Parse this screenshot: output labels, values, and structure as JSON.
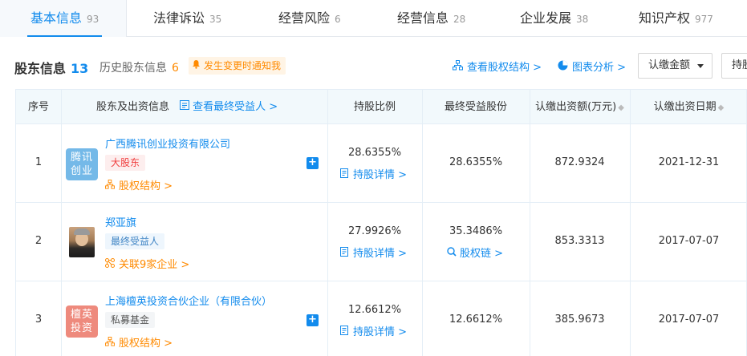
{
  "tabs": [
    {
      "label": "基本信息",
      "count": "93"
    },
    {
      "label": "法律诉讼",
      "count": "35"
    },
    {
      "label": "经营风险",
      "count": "6"
    },
    {
      "label": "经营信息",
      "count": "28"
    },
    {
      "label": "企业发展",
      "count": "38"
    },
    {
      "label": "知识产权",
      "count": "977"
    }
  ],
  "section": {
    "title": "股东信息",
    "count": "13",
    "history_label": "历史股东信息",
    "history_count": "6",
    "notice": "发生变更时通知我",
    "view_structure": "查看股权结构 >",
    "chart_analysis": "图表分析 >",
    "sort_select": "认缴金额",
    "sort_select2": "持股"
  },
  "table": {
    "headers": {
      "index": "序号",
      "shareholder": "股东及出资信息",
      "beneficiary_link": "查看最终受益人 >",
      "ratio": "持股比例",
      "final_share": "最终受益股份",
      "amount": "认缴出资额(万元)",
      "date": "认缴出资日期"
    },
    "rows": [
      {
        "index": "1",
        "logo_text": "腾讯创业",
        "name": "广西腾讯创业投资有限公司",
        "tag": "大股东",
        "sublink": "股权结构 >",
        "ratio": "28.6355%",
        "detail": "持股详情 >",
        "final_share": "28.6355%",
        "final_link": "",
        "amount": "872.9324",
        "date": "2021-12-31"
      },
      {
        "index": "2",
        "logo_text": "",
        "name": "郑亚旗",
        "tag": "最终受益人",
        "sublink": "关联9家企业 >",
        "ratio": "27.9926%",
        "detail": "持股详情 >",
        "final_share": "35.3486%",
        "final_link": "股权链 >",
        "amount": "853.3313",
        "date": "2017-07-07"
      },
      {
        "index": "3",
        "logo_text": "檀英投资",
        "name": "上海檀英投资合伙企业（有限合伙）",
        "tag": "私募基金",
        "sublink": "股权结构 >",
        "ratio": "12.6612%",
        "detail": "持股详情 >",
        "final_share": "12.6612%",
        "final_link": "",
        "amount": "385.9673",
        "date": "2017-07-07"
      }
    ]
  },
  "colors": {
    "accent": "#128bed",
    "warning": "#ff8a00",
    "tag_red": "#f04040"
  },
  "icons": {
    "structure": "org-chart-icon",
    "chart": "pie-chart-icon",
    "notice": "bell-icon",
    "detail": "document-icon",
    "chain": "chain-link-icon",
    "related": "network-icon",
    "plus": "plus-icon"
  }
}
